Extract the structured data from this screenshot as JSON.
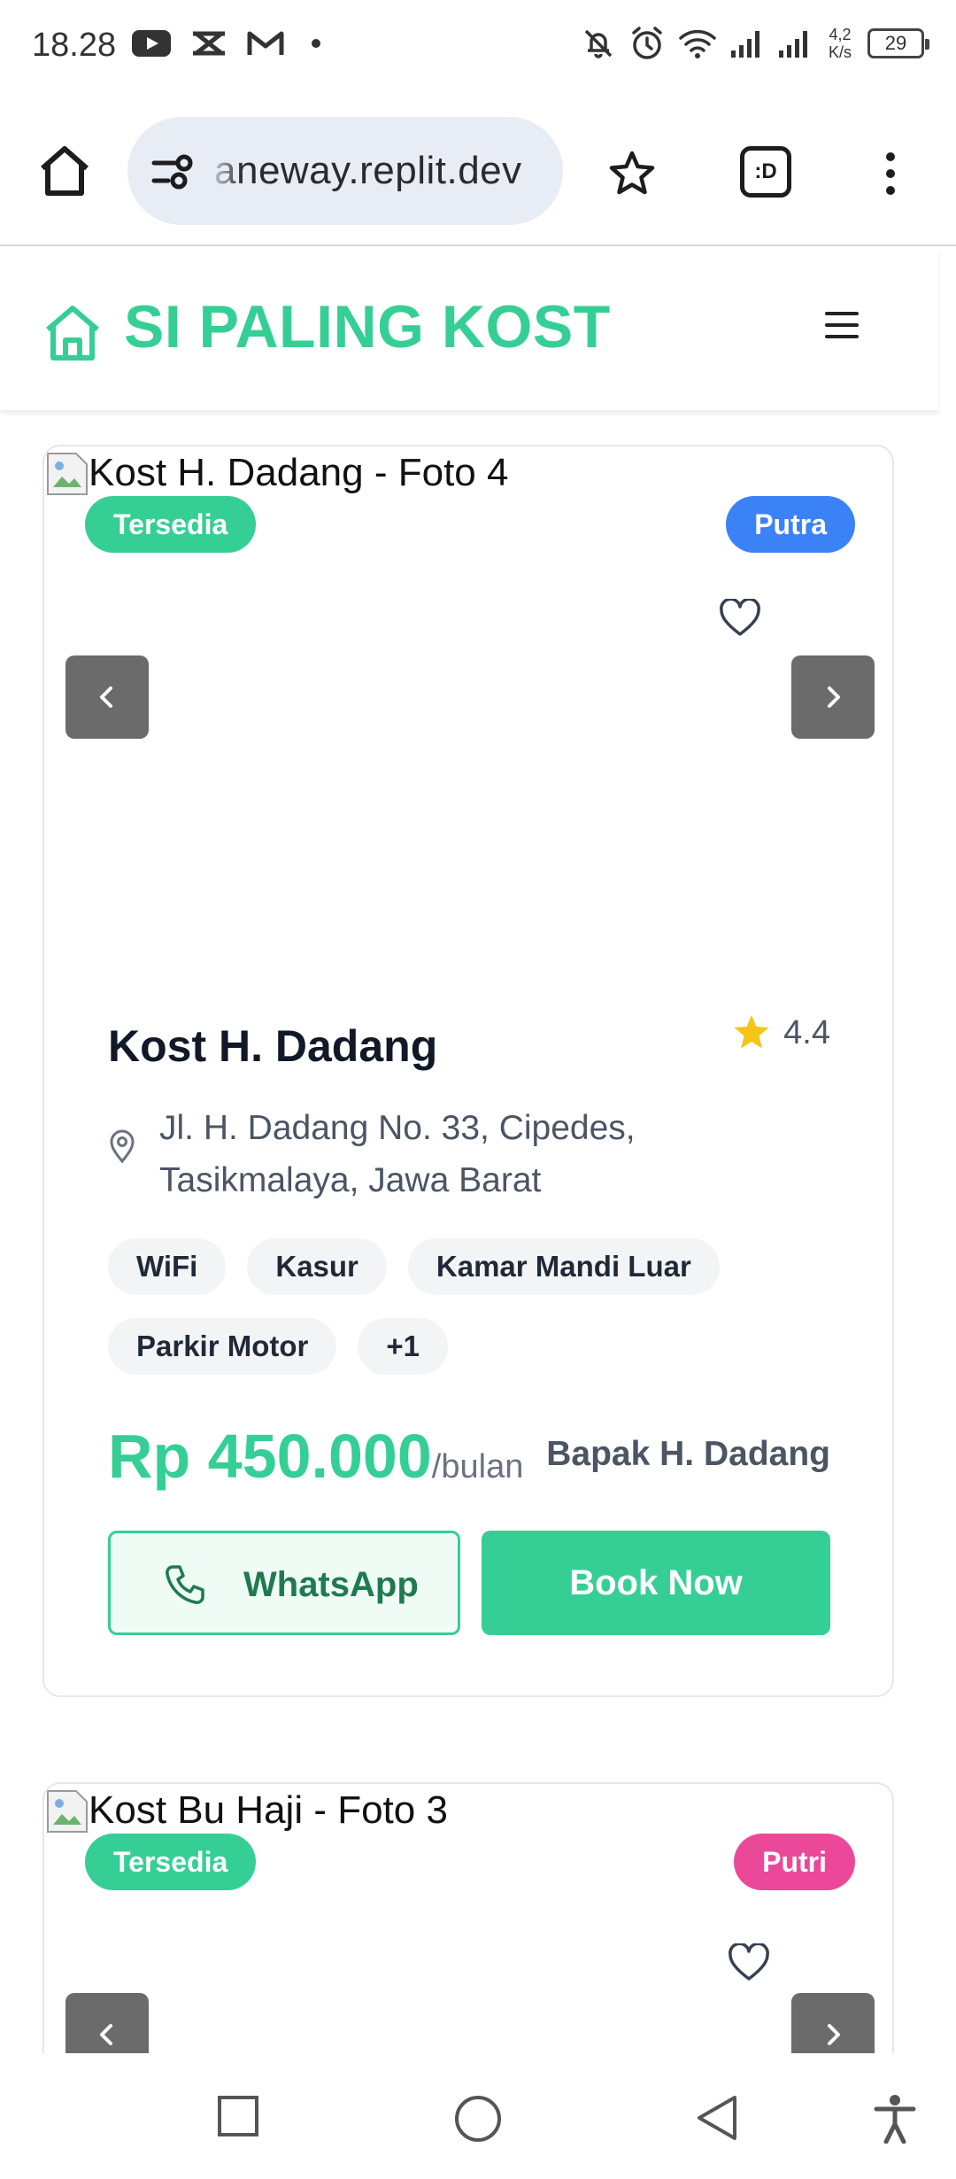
{
  "status_bar": {
    "time": "18.28",
    "net_speed_value": "4,2",
    "net_speed_unit": "K/s",
    "battery": "29",
    "icons": [
      "youtube-icon",
      "capcut-icon",
      "gmail-icon",
      "dot-icon",
      "mute-icon",
      "alarm-icon",
      "wifi-icon",
      "signal-icon",
      "signal-icon"
    ]
  },
  "browser": {
    "url": "aneway.replit.dev",
    "tabs_label": ":D",
    "icons": [
      "home-icon",
      "site-settings-icon",
      "bookmark-star-icon",
      "tabs-icon",
      "more-vert-icon"
    ]
  },
  "header": {
    "brand": "SI PALING KOST",
    "icons": [
      "home-outline-icon",
      "hamburger-menu-icon"
    ]
  },
  "colors": {
    "brand_green": "#35cf95",
    "blue_badge": "#3b82f6",
    "pink_badge": "#ec4899",
    "arrow_bg": "#6b6b6b",
    "star": "#f5c518"
  },
  "listings": [
    {
      "image_alt": "Kost H. Dadang - Foto 4",
      "status": "Tersedia",
      "type": "Putra",
      "name": "Kost H. Dadang",
      "rating": "4.4",
      "address": "Jl. H. Dadang No. 33, Cipedes, Tasikmalaya, Jawa Barat",
      "facilities": [
        "WiFi",
        "Kasur",
        "Kamar Mandi Luar",
        "Parkir Motor",
        "+1"
      ],
      "price": "Rp 450.000",
      "price_unit": "/bulan",
      "owner": "Bapak H. Dadang",
      "whatsapp_label": "WhatsApp",
      "book_label": "Book Now"
    },
    {
      "image_alt": "Kost Bu Haji - Foto 3",
      "status": "Tersedia",
      "type": "Putri"
    }
  ]
}
